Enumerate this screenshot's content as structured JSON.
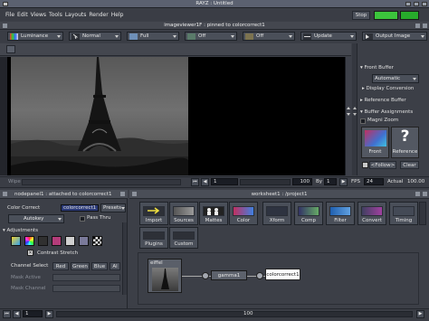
{
  "window": {
    "title": "RAYZ : Untitled"
  },
  "menu": [
    "File",
    "Edit",
    "Views",
    "Tools",
    "Layouts",
    "Render",
    "Help"
  ],
  "header": {
    "stop": "Stop"
  },
  "viewer": {
    "title": "imageviewer1F : pinned to colorcorrect1",
    "toolbar": {
      "luminance": "Luminance",
      "normal": "Normal",
      "full": "Full",
      "off1": "Off",
      "off2": "Off",
      "update": "Update",
      "output_image": "Output Image"
    }
  },
  "side": {
    "front_buffer": "Front Buffer",
    "automatic": "Automatic",
    "display_conversion": "Display Conversion",
    "reference_buffer": "Reference Buffer",
    "buffer_assignments": "Buffer Assignments",
    "magni_zoom": "Magni Zoom",
    "front": "Front",
    "reference": "Reference",
    "follow": "<Follow>",
    "clear": "Clear"
  },
  "timebar": {
    "wipe": "Wipe",
    "frame": "1",
    "end": "100",
    "by_label": "By",
    "by_value": "1",
    "fps_label": "FPS",
    "fps_value": "24",
    "actual_label": "Actual",
    "actual_value": "100.00"
  },
  "nodepanel": {
    "title": "nodepanel1 : attached to colorcorrect1",
    "color_correct_label": "Color Correct",
    "node_name": "colorcorrect1",
    "presets": "Presets",
    "autokey": "Autokey",
    "pass_thru": "Pass Thru",
    "adjustments": "Adjustments",
    "contrast_stretch": "Contrast Stretch",
    "channel_select": "Channel Select",
    "channels": [
      "Red",
      "Green",
      "Blue",
      "Al"
    ],
    "mask_active": "Mask Active",
    "mask_channel": "Mask Channel"
  },
  "worksheet": {
    "title": "worksheet1 : /project1",
    "buttons": [
      "Import",
      "Sources",
      "Mattes",
      "Color",
      "Xform",
      "Comp",
      "Filter",
      "Convert",
      "Timing",
      "Plugins",
      "Custom"
    ],
    "nodes": {
      "eiffel": "eiffel",
      "gamma": "gamma1",
      "colorcorrect": "colorcorrect1"
    }
  },
  "bottom": {
    "frame": "1",
    "end": "100"
  }
}
